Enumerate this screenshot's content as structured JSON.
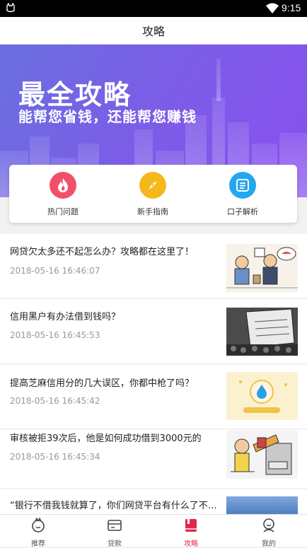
{
  "status_bar": {
    "time": "9:15"
  },
  "header": {
    "title": "攻略"
  },
  "banner": {
    "headline": "最全攻略",
    "subline": "能帮您省钱，还能帮您赚钱"
  },
  "quick_links": [
    {
      "label": "热门问题",
      "icon": "fire-icon",
      "color": "#f2506a"
    },
    {
      "label": "新手指南",
      "icon": "compass-icon",
      "color": "#f5b81c"
    },
    {
      "label": "口子解析",
      "icon": "document-icon",
      "color": "#23a7f0"
    }
  ],
  "articles": [
    {
      "title": "网贷欠太多还不起怎么办？攻略都在这里了！",
      "date": "2018-05-16 16:46:07",
      "thumb": "cartoon-borrowing-image"
    },
    {
      "title": "信用黑户有办法借到钱吗？",
      "date": "2018-05-16 16:45:53",
      "thumb": "blacklist-image"
    },
    {
      "title": "提高芝麻信用分的几大误区，你都中枪了吗？",
      "date": "2018-05-16 16:45:42",
      "thumb": "sesame-credit-image"
    },
    {
      "title": "审核被拒39次后，他是如何成功借到3000元的",
      "date": "2018-05-16 16:45:34",
      "thumb": "bank-rejection-image"
    },
    {
      "title": "“银行不借我钱就算了，你们网贷平台有什么了不起...",
      "date": "",
      "thumb": "sky-image"
    }
  ],
  "tabs": [
    {
      "label": "推荐",
      "icon": "recommend-icon",
      "active": false
    },
    {
      "label": "贷款",
      "icon": "wallet-icon",
      "active": false
    },
    {
      "label": "攻略",
      "icon": "book-icon",
      "active": true
    },
    {
      "label": "我的",
      "icon": "profile-icon",
      "active": false
    }
  ],
  "colors": {
    "accent": "#e0284a",
    "banner": "#7a5ee6"
  }
}
